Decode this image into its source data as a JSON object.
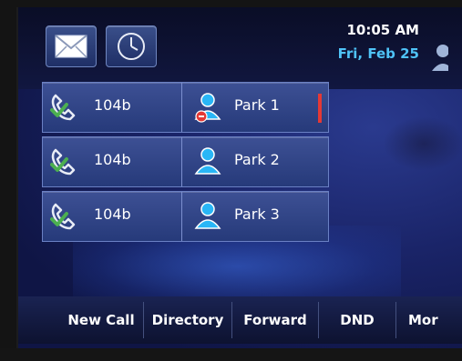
{
  "header": {
    "time": "10:05 AM",
    "date": "Fri, Feb 25"
  },
  "top_icons": [
    {
      "name": "mail-icon"
    },
    {
      "name": "clock-icon"
    }
  ],
  "lines": [
    {
      "line": "104b",
      "park": "Park 1",
      "state": "active"
    },
    {
      "line": "104b",
      "park": "Park 2",
      "state": "idle"
    },
    {
      "line": "104b",
      "park": "Park 3",
      "state": "idle"
    }
  ],
  "softkeys": [
    "New Call",
    "Directory",
    "Forward",
    "DND",
    "Mor"
  ],
  "colors": {
    "date": "#4fc3f7",
    "active_indicator": "#e53935",
    "phone_icon": "#4caf50",
    "user_icon": "#29b6f6"
  }
}
